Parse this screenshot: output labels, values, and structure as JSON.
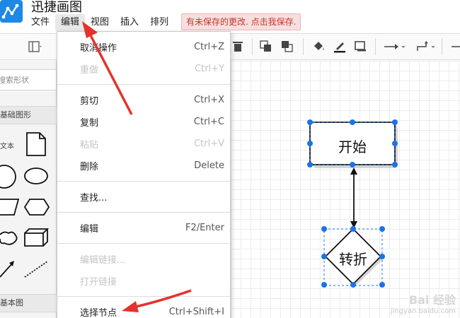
{
  "app": {
    "title": "迅捷画图",
    "unsaved_notice": "有未保存的更改. 点击我保存."
  },
  "menubar": {
    "items": [
      {
        "label": "文件"
      },
      {
        "label": "编辑"
      },
      {
        "label": "视图"
      },
      {
        "label": "插入"
      },
      {
        "label": "排列"
      }
    ]
  },
  "sidebar": {
    "search_placeholder": "搜索形状",
    "section_basic": "基础图形",
    "text_shape_label": "文本",
    "section_more": "基本图"
  },
  "edit_menu": {
    "items": [
      {
        "label": "取消操作",
        "shortcut": "Ctrl+Z",
        "enabled": true
      },
      {
        "label": "重做",
        "shortcut": "Ctrl+Y",
        "enabled": false
      },
      {
        "label": "剪切",
        "shortcut": "Ctrl+X",
        "enabled": true
      },
      {
        "label": "复制",
        "shortcut": "Ctrl+C",
        "enabled": true
      },
      {
        "label": "粘贴",
        "shortcut": "Ctrl+V",
        "enabled": false
      },
      {
        "label": "删除",
        "shortcut": "Delete",
        "enabled": true
      },
      {
        "label": "查找...",
        "shortcut": "",
        "enabled": true
      },
      {
        "label": "编辑",
        "shortcut": "F2/Enter",
        "enabled": true
      },
      {
        "label": "编辑链接...",
        "shortcut": "",
        "enabled": false
      },
      {
        "label": "打开链接",
        "shortcut": "",
        "enabled": false
      },
      {
        "label": "选择节点",
        "shortcut": "Ctrl+Shift+I",
        "enabled": true
      }
    ]
  },
  "diagram": {
    "start_label": "开始",
    "decision_label": "转折"
  },
  "watermark": {
    "brand": "Bai 经验",
    "url": "jingyan.baidu.com"
  },
  "colors": {
    "accent": "#1e88e5",
    "handle": "#1a73e8",
    "annotation_red": "#e5322d",
    "unsaved_bg": "#f8dede",
    "unsaved_text": "#c0392b"
  }
}
